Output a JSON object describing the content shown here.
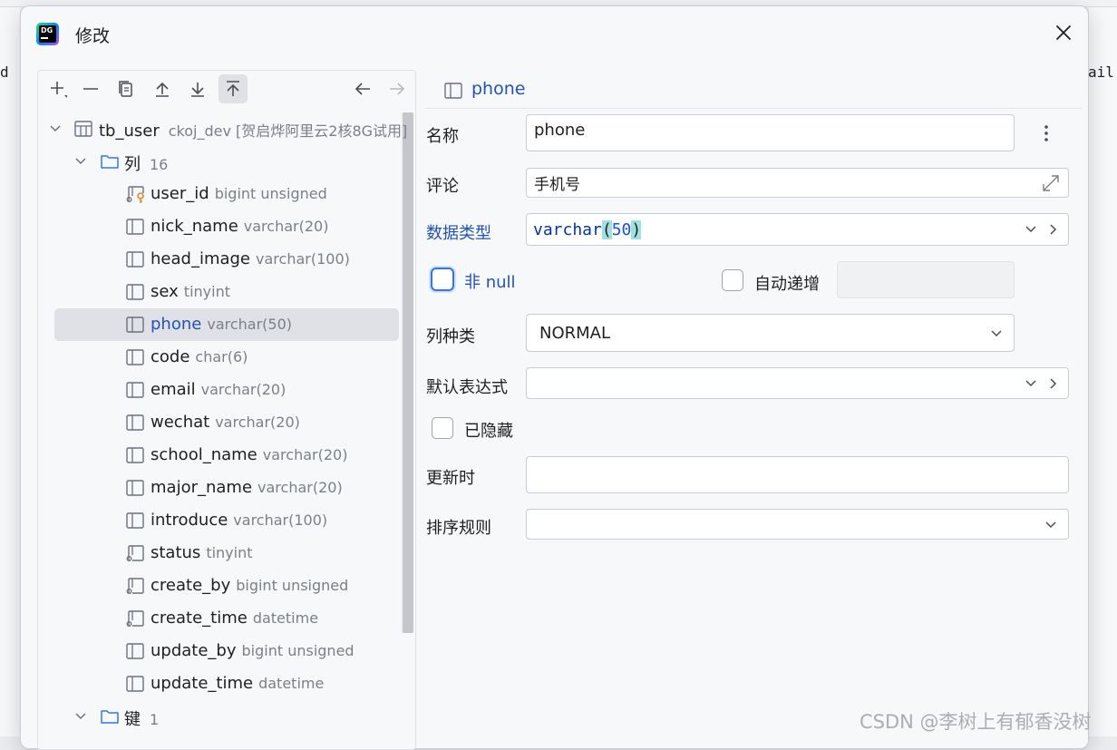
{
  "background": {
    "left_text": "d",
    "right_text": "ail"
  },
  "dialog": {
    "title": "修改"
  },
  "tree": {
    "table_name": "tb_user",
    "table_context": "ckoj_dev [贺启烨阿里云2核8G试用]",
    "columns_folder": {
      "label": "列",
      "count": "16"
    },
    "columns": [
      {
        "name": "user_id",
        "type": "bigint unsigned",
        "icon": "key-column-icon"
      },
      {
        "name": "nick_name",
        "type": "varchar(20)",
        "icon": "column-icon"
      },
      {
        "name": "head_image",
        "type": "varchar(100)",
        "icon": "column-icon"
      },
      {
        "name": "sex",
        "type": "tinyint",
        "icon": "column-icon"
      },
      {
        "name": "phone",
        "type": "varchar(50)",
        "icon": "column-icon",
        "selected": true
      },
      {
        "name": "code",
        "type": "char(6)",
        "icon": "column-icon"
      },
      {
        "name": "email",
        "type": "varchar(20)",
        "icon": "column-icon"
      },
      {
        "name": "wechat",
        "type": "varchar(20)",
        "icon": "column-icon"
      },
      {
        "name": "school_name",
        "type": "varchar(20)",
        "icon": "column-icon"
      },
      {
        "name": "major_name",
        "type": "varchar(20)",
        "icon": "column-icon"
      },
      {
        "name": "introduce",
        "type": "varchar(100)",
        "icon": "column-icon"
      },
      {
        "name": "status",
        "type": "tinyint",
        "icon": "notnull-column-icon"
      },
      {
        "name": "create_by",
        "type": "bigint unsigned",
        "icon": "notnull-column-icon"
      },
      {
        "name": "create_time",
        "type": "datetime",
        "icon": "notnull-column-icon"
      },
      {
        "name": "update_by",
        "type": "bigint unsigned",
        "icon": "column-icon"
      },
      {
        "name": "update_time",
        "type": "datetime",
        "icon": "column-icon"
      }
    ],
    "keys_folder": {
      "label": "键",
      "count": "1"
    }
  },
  "form": {
    "header": "phone",
    "name_label": "名称",
    "name_value": "phone",
    "comment_label": "评论",
    "comment_value": "手机号",
    "datatype_label": "数据类型",
    "datatype_name": "varchar",
    "datatype_open": "(",
    "datatype_size": "50",
    "datatype_close": ")",
    "notnull_label": "非 null",
    "autoinc_label": "自动递增",
    "column_kind_label": "列种类",
    "column_kind_value": "NORMAL",
    "default_expr_label": "默认表达式",
    "hidden_label": "已隐藏",
    "on_update_label": "更新时",
    "collation_label": "排序规则"
  },
  "watermark": "CSDN @李树上有郁香没树"
}
